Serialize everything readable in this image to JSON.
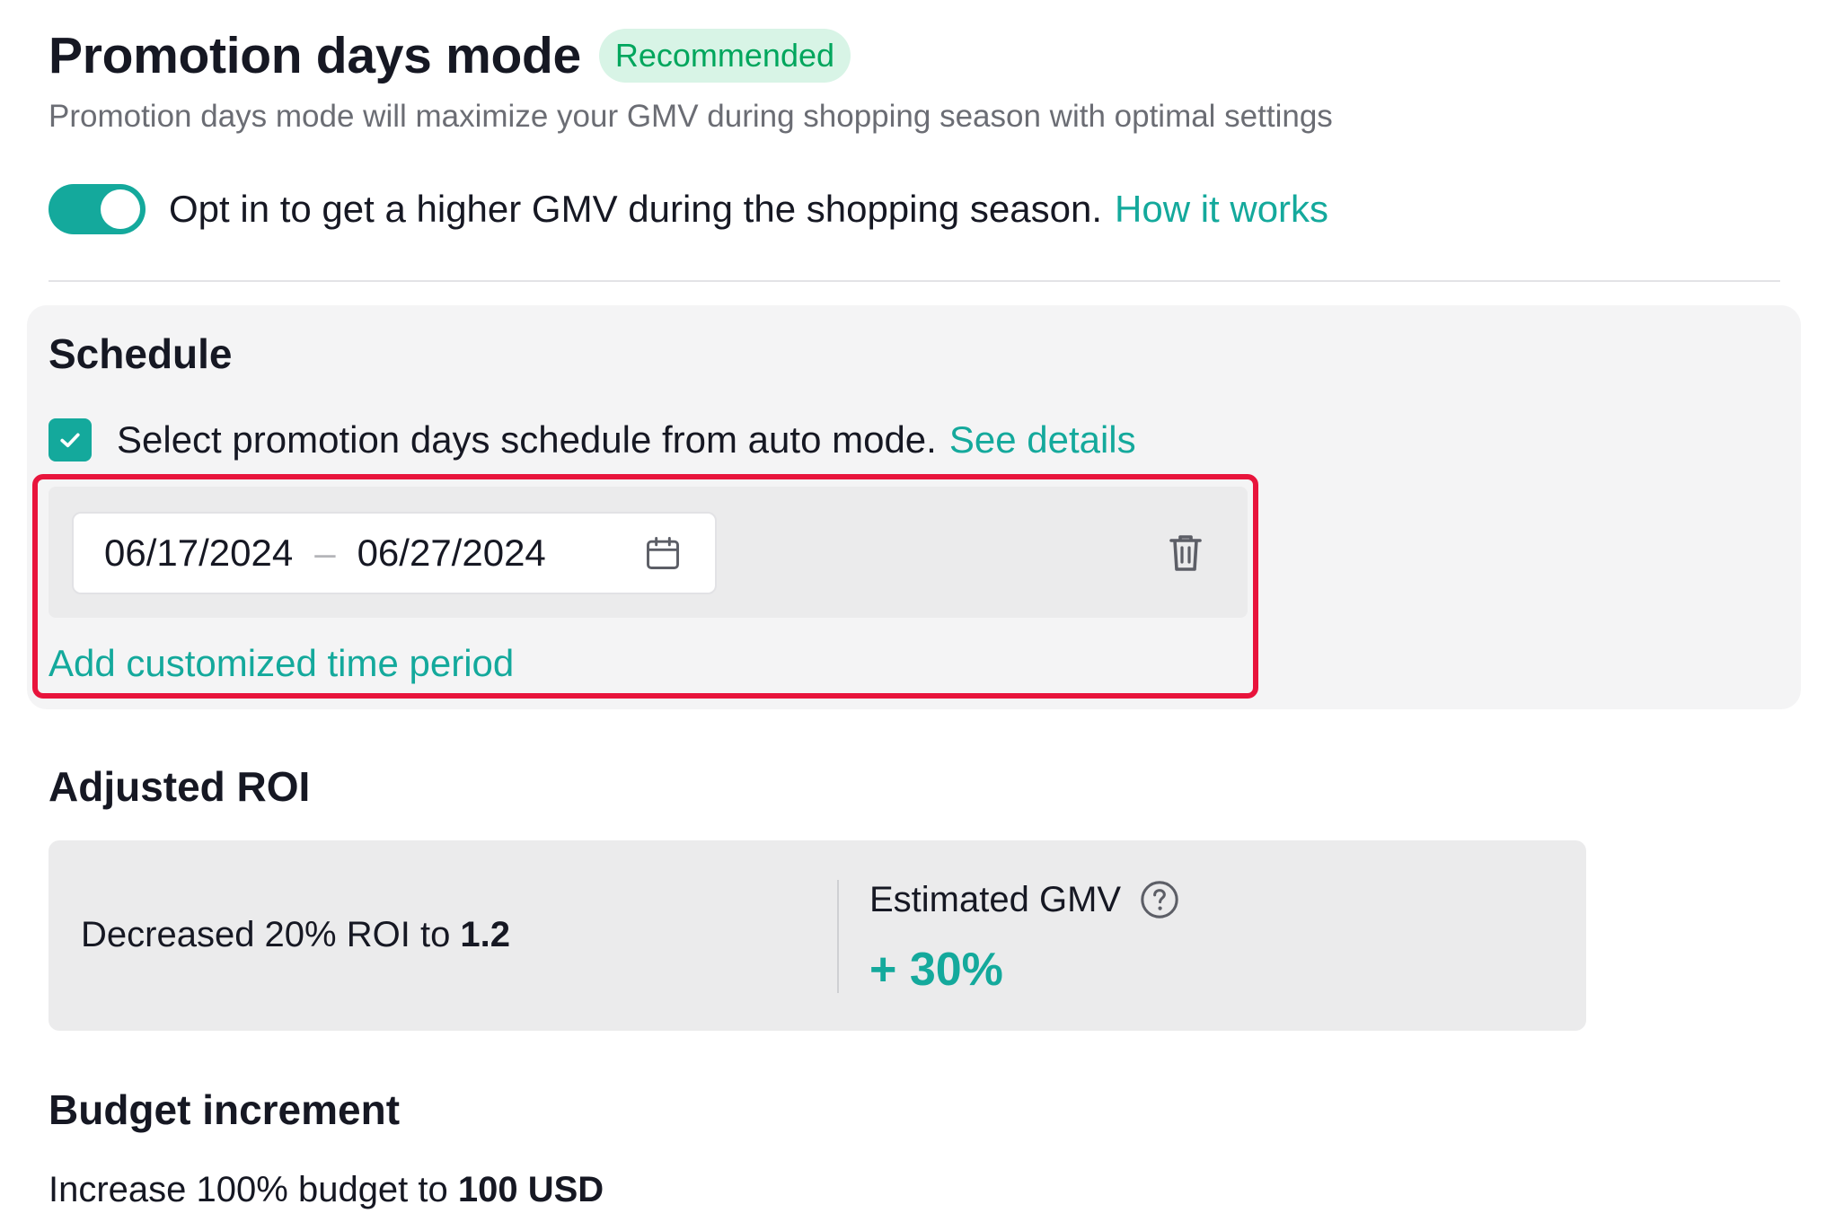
{
  "header": {
    "title": "Promotion days mode",
    "badge": "Recommended",
    "subtitle": "Promotion days mode will maximize your GMV during shopping season with optimal settings"
  },
  "opt_in": {
    "enabled": true,
    "text": "Opt in to get a higher GMV during the shopping season.",
    "link": "How it works"
  },
  "schedule": {
    "title": "Schedule",
    "auto_mode_checked": true,
    "auto_mode_text": "Select promotion days schedule from auto mode.",
    "auto_mode_link": "See details",
    "date_range": {
      "start": "06/17/2024",
      "separator": "–",
      "end": "06/27/2024"
    },
    "add_period": "Add customized time period"
  },
  "roi": {
    "title": "Adjusted ROI",
    "decrease_text": "Decreased 20% ROI to ",
    "decrease_value": "1.2",
    "gmv_label": "Estimated GMV",
    "gmv_value": "+ 30%"
  },
  "budget": {
    "title": "Budget increment",
    "text": "Increase 100% budget to ",
    "value": "100 USD"
  },
  "colors": {
    "accent": "#14a99c",
    "badge_text": "#00a65d",
    "badge_bg": "#d8f4e6",
    "highlight_border": "#e8143c"
  },
  "icons": [
    "check-icon",
    "calendar-icon",
    "trash-icon",
    "help-circle-icon"
  ]
}
